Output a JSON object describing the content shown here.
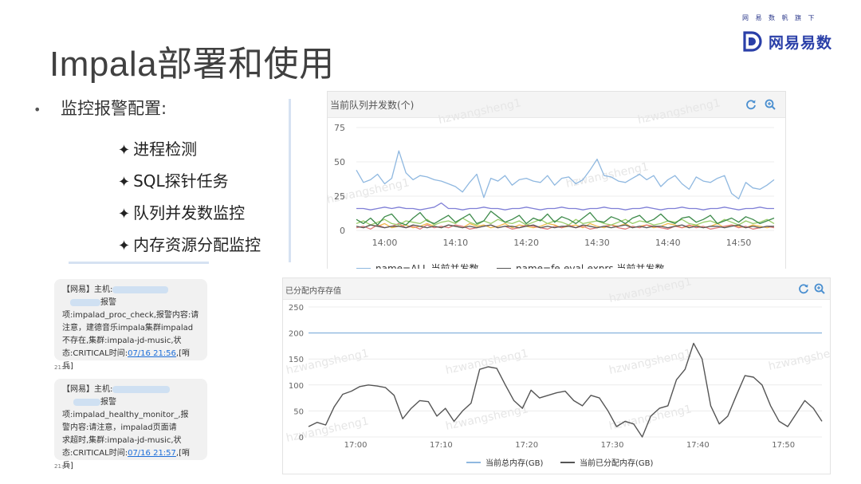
{
  "brand": {
    "tagline": "网易数帆旗下",
    "logo_text": "网易易数",
    "accent": "#2a3fa8"
  },
  "page": {
    "title": "Impala部署和使用",
    "bullet": "•",
    "main_point": "监控报警配置:",
    "items": [
      {
        "star": "✦",
        "label": "进程检测"
      },
      {
        "star": "✦",
        "label": "SQL探针任务"
      },
      {
        "star": "✦",
        "label": "队列并发数监控"
      },
      {
        "star": "✦",
        "label": "内存资源分配监控"
      }
    ]
  },
  "sms": [
    {
      "prefix": "【网易】主机:",
      "alarm_word": "报警",
      "body_1": "项:impalad_proc_check,报警内容:请",
      "body_2": "注意，建德音乐impala集群impalad",
      "body_3": "不存在,集群:impala-jd-music,状",
      "status_prefix": "态:CRITICAL时间:",
      "time_link": "07/16 21:56",
      "suffix": ",[哨兵]",
      "timestamp": "21:56"
    },
    {
      "prefix": "【网易】主机:",
      "alarm_word": "报警",
      "body_1": "项:impalad_healthy_monitor_,报",
      "body_2": "警内容:请注意，impalad页面请",
      "body_3": "求超时,集群:impala-jd-music,状",
      "status_prefix": "态:CRITICAL时间:",
      "time_link": "07/16 21:57",
      "suffix": ",[哨兵]",
      "timestamp": "21:57"
    }
  ],
  "watermark": "hzwangsheng1",
  "chart_data": [
    {
      "type": "line",
      "title": "当前队列并发数(个)",
      "xlabel": "",
      "ylabel": "",
      "x_ticks": [
        "14:00",
        "14:10",
        "14:20",
        "14:30",
        "14:40",
        "14:50"
      ],
      "ylim": [
        0,
        75
      ],
      "y_ticks": [
        0,
        25,
        50,
        75
      ],
      "grid": true,
      "legend_position": "bottom",
      "x_start_min": -4,
      "x_end_min": 55,
      "series": [
        {
          "name": "name=ALL 当前并发数",
          "color": "#8fb8e0",
          "values": [
            44,
            35,
            37,
            41,
            34,
            38,
            58,
            42,
            37,
            40,
            39,
            37,
            36,
            34,
            32,
            28,
            35,
            41,
            24,
            38,
            36,
            40,
            33,
            37,
            38,
            36,
            35,
            40,
            33,
            38,
            39,
            34,
            37,
            44,
            52,
            40,
            39,
            36,
            35,
            38,
            41,
            37,
            40,
            32,
            37,
            40,
            34,
            30,
            39,
            36,
            35,
            38,
            40,
            27,
            23,
            35,
            31,
            30,
            33,
            37
          ]
        },
        {
          "name": "name=fe-eval-exprs 当前并发数",
          "color": "#555555",
          "values": [
            3,
            2,
            4,
            3,
            2,
            3,
            3,
            2,
            4,
            3,
            2,
            3,
            2,
            4,
            3,
            2,
            3,
            2,
            3,
            4,
            2,
            3,
            3,
            2,
            3,
            4,
            2,
            3,
            2,
            3,
            3,
            2,
            4,
            3,
            2,
            3,
            2,
            3,
            4,
            2,
            3,
            2,
            3,
            3,
            2,
            3,
            4,
            2,
            3,
            2,
            3,
            3,
            2,
            3,
            4,
            2,
            3,
            2,
            3,
            3
          ]
        },
        {
          "color": "#7f7fd6",
          "values": [
            16,
            16,
            15,
            16,
            17,
            16,
            17,
            16,
            16,
            15,
            16,
            17,
            20,
            16,
            16,
            15,
            16,
            16,
            17,
            16,
            16,
            15,
            16,
            16,
            17,
            16,
            15,
            16,
            16,
            17,
            16,
            16,
            15,
            16,
            16,
            17,
            16,
            16,
            15,
            16,
            16,
            17,
            16,
            15,
            16,
            16,
            17,
            16,
            16,
            15,
            16,
            16,
            17,
            16,
            15,
            16,
            16,
            17,
            16,
            16
          ]
        },
        {
          "color": "#3d8a4a",
          "values": [
            8,
            5,
            9,
            4,
            10,
            12,
            6,
            4,
            9,
            13,
            7,
            5,
            8,
            11,
            6,
            9,
            12,
            5,
            7,
            14,
            10,
            6,
            8,
            11,
            5,
            9,
            7,
            12,
            6,
            10,
            8,
            5,
            9,
            13,
            7,
            6,
            10,
            8,
            5,
            9,
            11,
            6,
            8,
            12,
            7,
            5,
            9,
            10,
            6,
            8,
            11,
            5,
            7,
            9,
            6,
            10,
            8,
            5,
            7,
            9
          ]
        },
        {
          "color": "#9acd6a",
          "values": [
            5,
            7,
            4,
            6,
            8,
            5,
            4,
            7,
            6,
            5,
            8,
            4,
            6,
            7,
            5,
            9,
            6,
            4,
            7,
            5,
            8,
            6,
            5,
            7,
            4,
            6,
            8,
            5,
            7,
            6,
            4,
            8,
            5,
            6,
            7,
            5,
            4,
            6,
            8,
            5,
            7,
            6,
            4,
            5,
            7,
            6,
            8,
            5,
            4,
            6,
            7,
            5,
            8,
            6,
            4,
            7,
            5,
            6,
            8,
            5
          ]
        },
        {
          "color": "#e07b7b",
          "values": [
            2,
            3,
            1,
            4,
            2,
            3,
            5,
            2,
            3,
            1,
            4,
            2,
            3,
            2,
            4,
            3,
            1,
            2,
            3,
            4,
            2,
            3,
            1,
            2,
            4,
            3,
            2,
            1,
            3,
            2,
            4,
            2,
            3,
            1,
            2,
            3,
            4,
            2,
            1,
            3,
            2,
            4,
            3,
            2,
            1,
            3,
            2,
            4,
            2,
            3,
            1,
            2,
            3,
            4,
            2,
            3,
            1,
            2,
            3,
            2
          ]
        },
        {
          "color": "#f0b84a",
          "values": [
            3,
            2,
            4,
            3,
            5,
            2,
            3,
            4,
            2,
            3,
            5,
            3,
            2,
            4,
            3,
            2,
            5,
            3,
            4,
            2,
            3,
            5,
            2,
            4,
            3,
            2,
            3,
            5,
            4,
            2,
            3,
            4,
            2,
            5,
            3,
            2,
            4,
            3,
            5,
            2,
            3,
            4,
            2,
            3,
            5,
            4,
            2,
            3,
            4,
            2,
            3,
            5,
            2,
            4,
            3,
            2,
            4,
            3,
            2,
            3
          ]
        }
      ]
    },
    {
      "type": "line",
      "title": "已分配内存存值",
      "xlabel": "",
      "ylabel": "",
      "x_ticks": [
        "17:00",
        "17:10",
        "17:20",
        "17:30",
        "17:40",
        "17:50"
      ],
      "ylim": [
        0,
        250
      ],
      "y_ticks": [
        0,
        50,
        100,
        150,
        200,
        250
      ],
      "grid": true,
      "legend_position": "bottom",
      "x_start_min": -5.5,
      "x_end_min": 54.5,
      "series": [
        {
          "name": "当前总内存(GB)",
          "color": "#8fb8e0",
          "values": [
            200,
            200,
            200,
            200,
            200,
            200,
            200,
            200,
            200,
            200,
            200,
            200,
            200,
            200,
            200,
            200,
            200,
            200,
            200,
            200,
            200,
            200,
            200,
            200,
            200,
            200,
            200,
            200,
            200,
            200,
            200,
            200,
            200,
            200,
            200,
            200,
            200,
            200,
            200,
            200,
            200,
            200,
            200,
            200,
            200,
            200,
            200,
            200,
            200,
            200,
            200,
            200,
            200,
            200,
            200,
            200,
            200,
            200,
            200,
            200,
            200
          ]
        },
        {
          "name": "当前已分配内存(GB)",
          "color": "#555555",
          "values": [
            20,
            28,
            23,
            58,
            82,
            88,
            97,
            100,
            98,
            95,
            80,
            35,
            55,
            70,
            68,
            40,
            55,
            30,
            50,
            65,
            130,
            135,
            132,
            100,
            70,
            55,
            90,
            75,
            80,
            85,
            88,
            70,
            60,
            80,
            75,
            50,
            20,
            30,
            25,
            0,
            40,
            55,
            60,
            110,
            130,
            180,
            150,
            60,
            25,
            40,
            80,
            118,
            115,
            100,
            60,
            30,
            20,
            45,
            70,
            55,
            30
          ]
        }
      ]
    }
  ]
}
